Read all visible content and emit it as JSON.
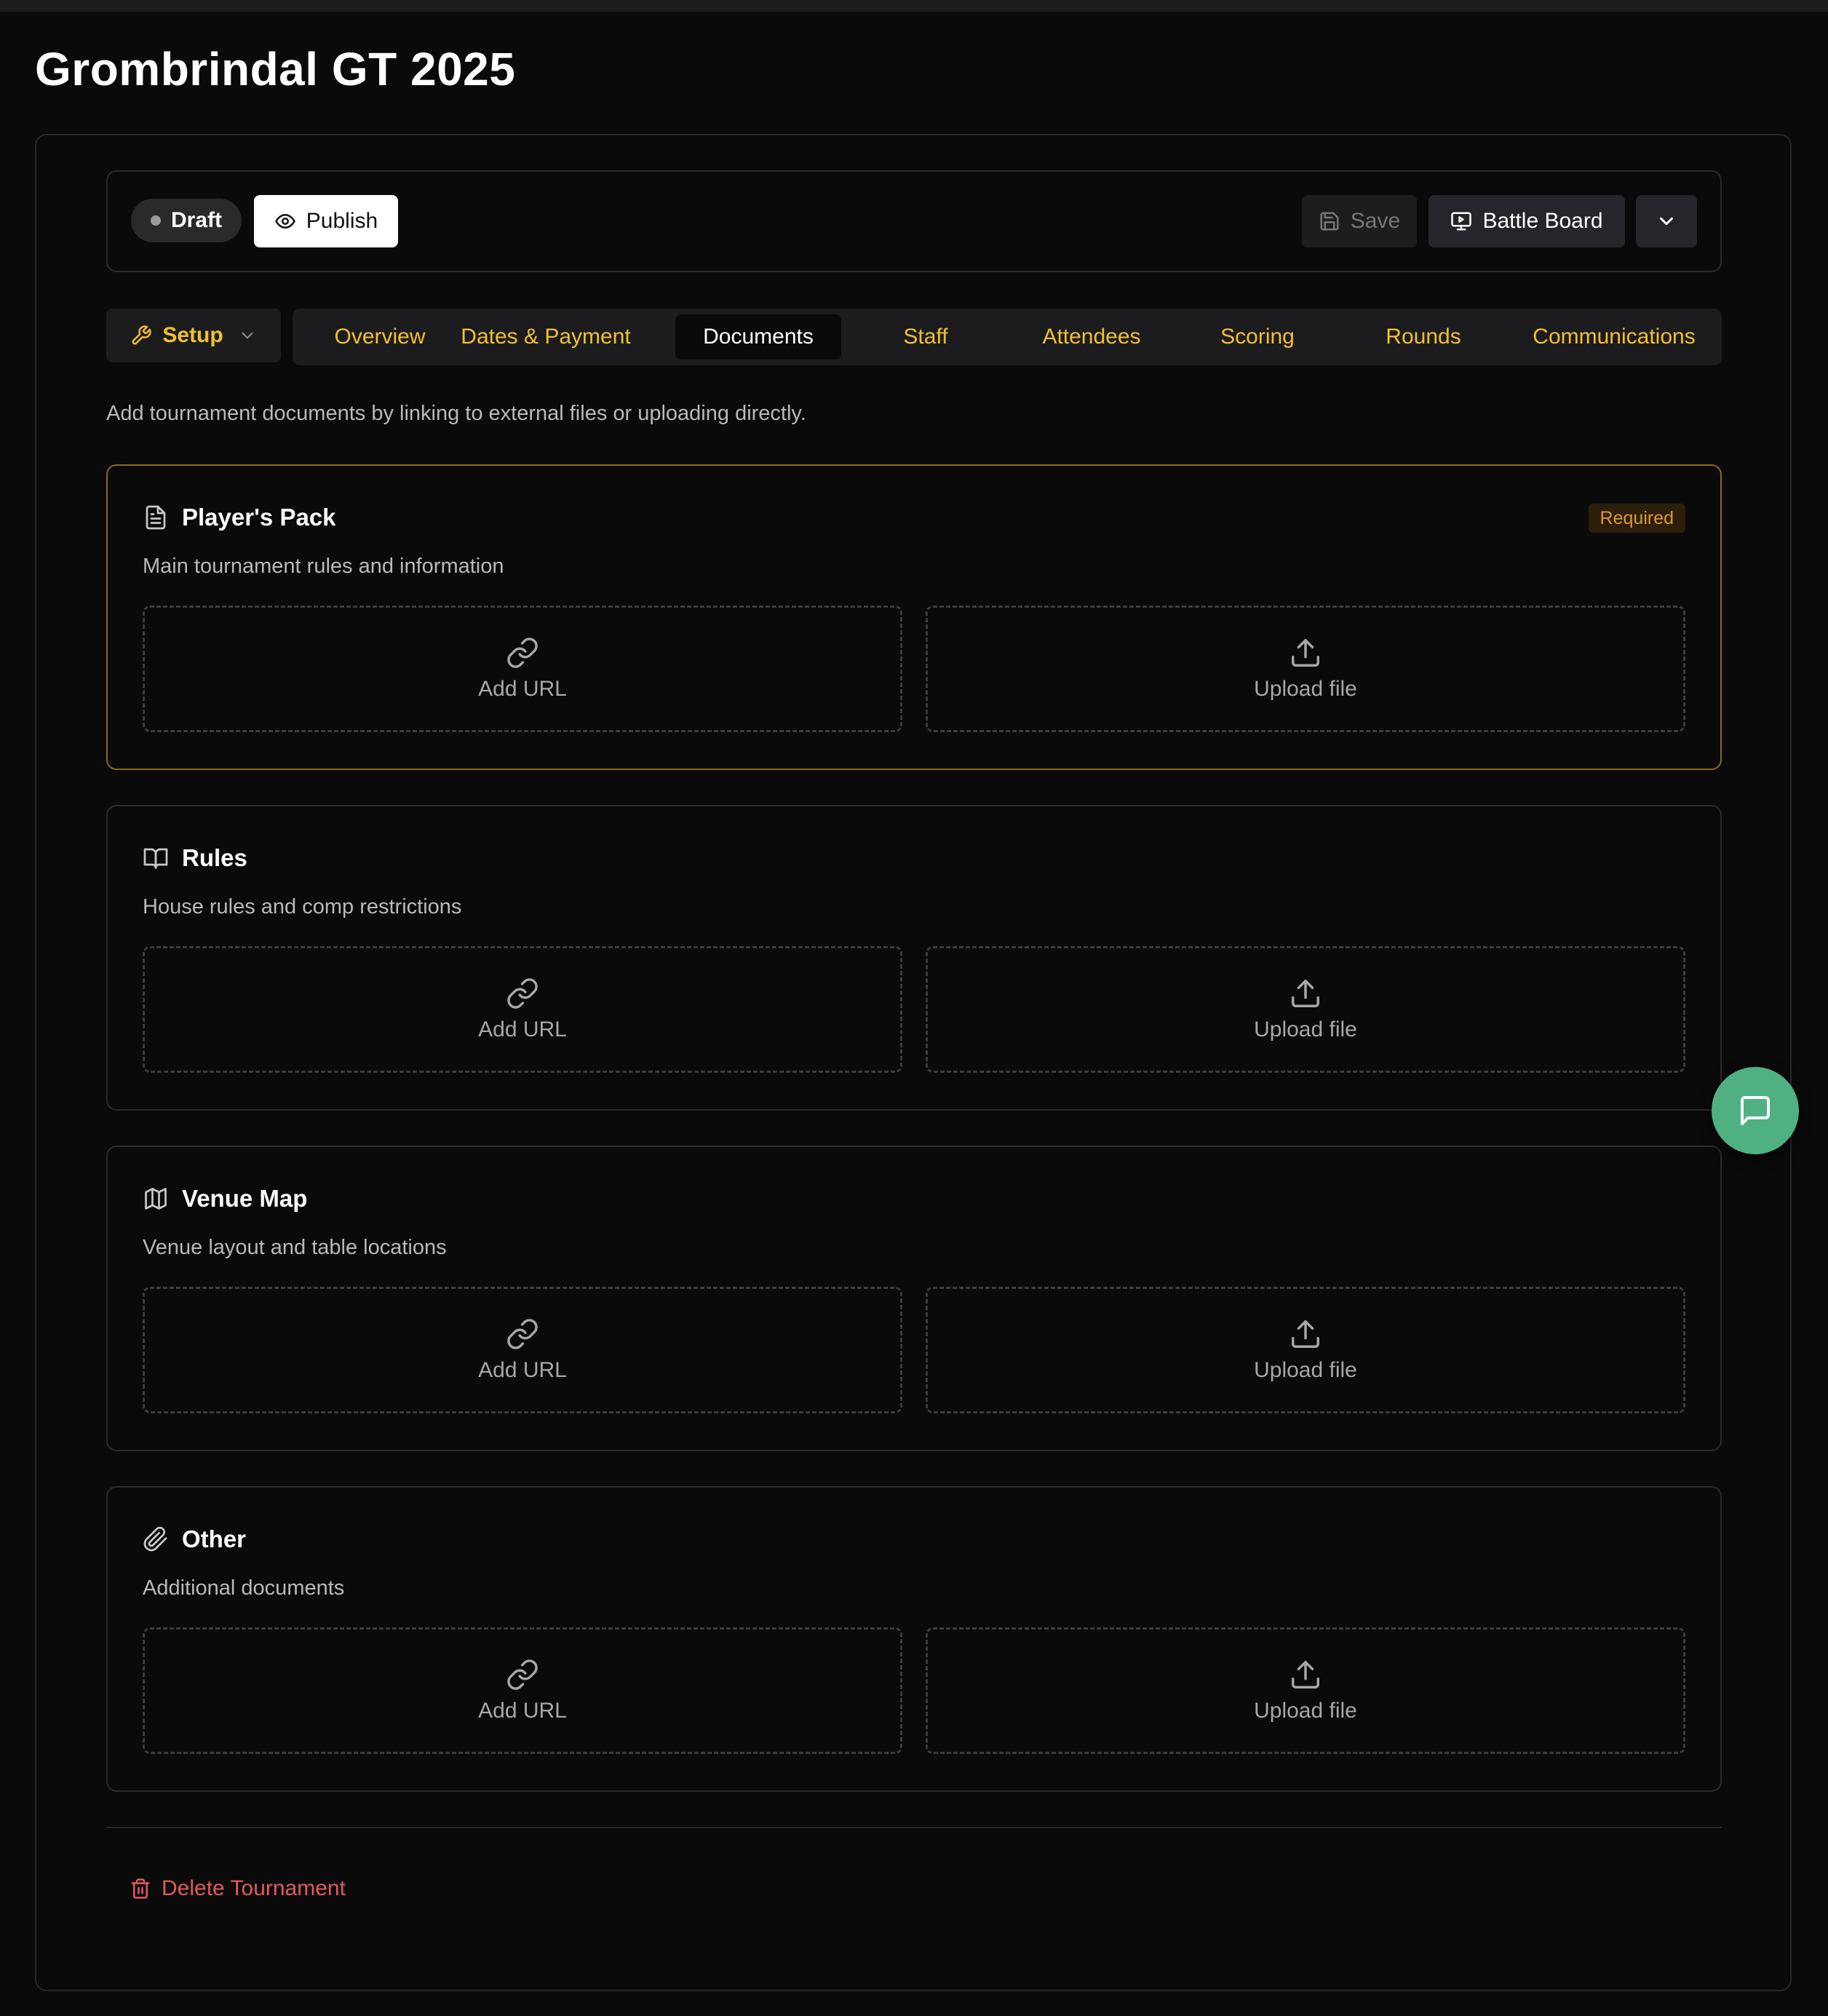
{
  "page": {
    "title": "Grombrindal GT 2025"
  },
  "toolbar": {
    "status_label": "Draft",
    "publish_label": "Publish",
    "save_label": "Save",
    "battle_board_label": "Battle Board"
  },
  "nav": {
    "setup_label": "Setup",
    "tabs": [
      {
        "label": "Overview"
      },
      {
        "label": "Dates & Payment"
      },
      {
        "label": "Documents",
        "active": true
      },
      {
        "label": "Staff"
      },
      {
        "label": "Attendees"
      },
      {
        "label": "Scoring"
      },
      {
        "label": "Rounds"
      },
      {
        "label": "Communications"
      }
    ]
  },
  "intro": "Add tournament documents by linking to external files or uploading directly.",
  "documents": [
    {
      "icon": "file-text-icon",
      "title": "Player's Pack",
      "description": "Main tournament rules and information",
      "badge": "Required",
      "add_url": "Add URL",
      "upload": "Upload file"
    },
    {
      "icon": "book-open-icon",
      "title": "Rules",
      "description": "House rules and comp restrictions",
      "add_url": "Add URL",
      "upload": "Upload file"
    },
    {
      "icon": "map-icon",
      "title": "Venue Map",
      "description": "Venue layout and table locations",
      "add_url": "Add URL",
      "upload": "Upload file"
    },
    {
      "icon": "paperclip-icon",
      "title": "Other",
      "description": "Additional documents",
      "add_url": "Add URL",
      "upload": "Upload file"
    }
  ],
  "danger": {
    "delete_label": "Delete Tournament"
  },
  "colors": {
    "accent": "#f0c030",
    "danger": "#e35a5a",
    "fab": "#4fb182",
    "required_border": "#8a6a16"
  }
}
